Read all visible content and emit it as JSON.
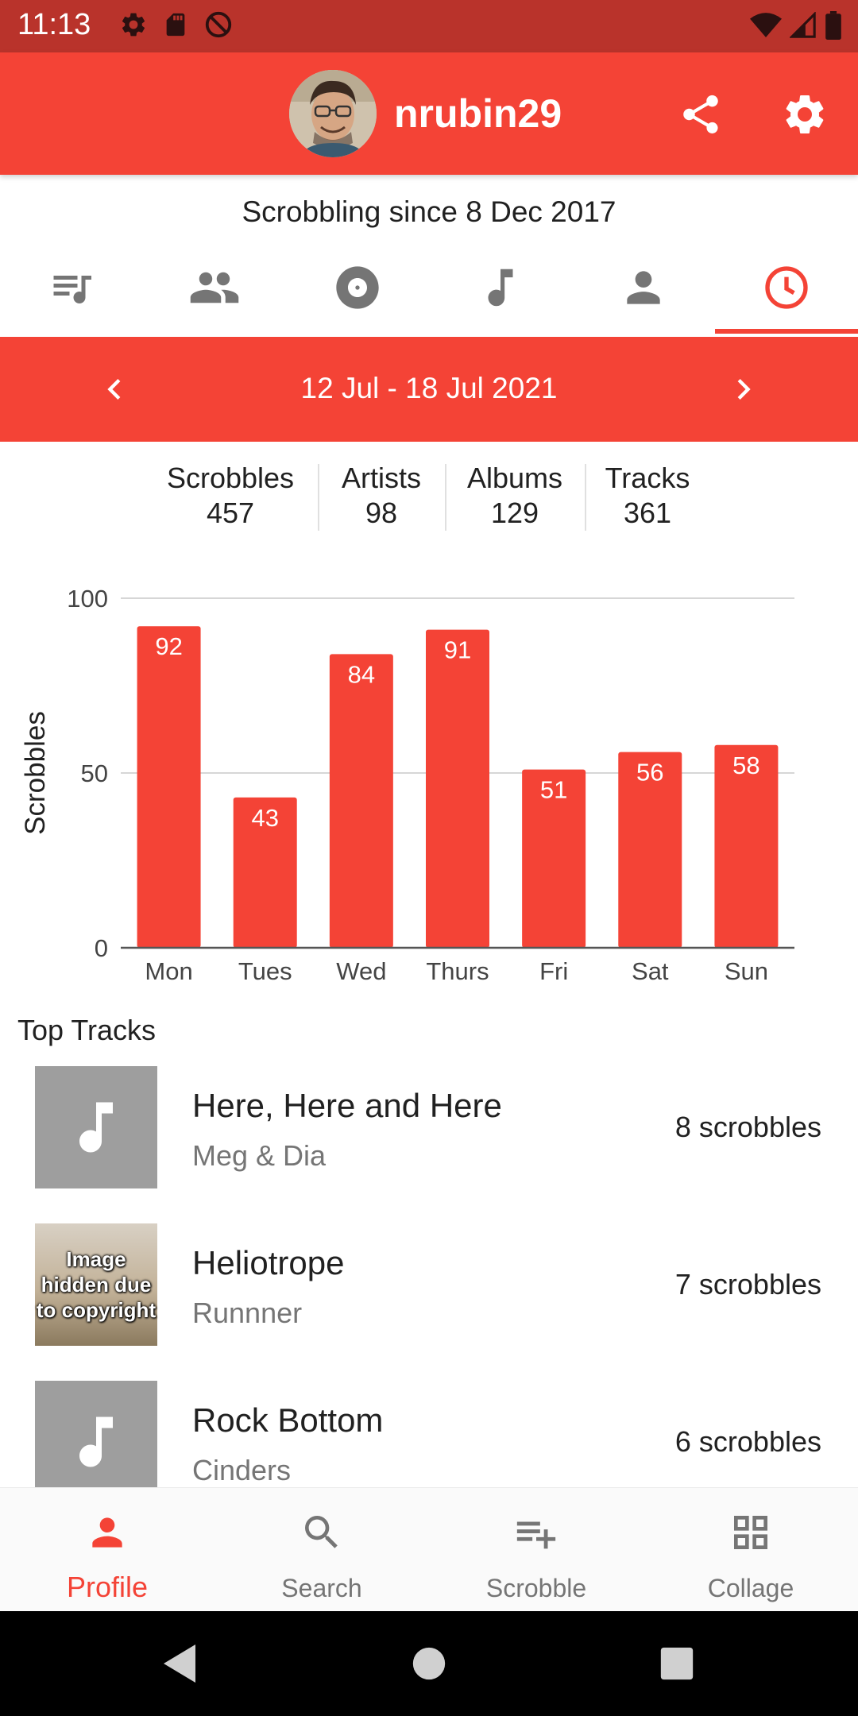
{
  "status_bar": {
    "time": "11:13"
  },
  "header": {
    "username": "nrubin29"
  },
  "profile": {
    "since": "Scrobbling since 8 Dec 2017"
  },
  "tabs": [
    {
      "name": "recent-tracks",
      "icon": "queue-music-icon"
    },
    {
      "name": "friends",
      "icon": "people-icon"
    },
    {
      "name": "albums",
      "icon": "album-icon"
    },
    {
      "name": "tracks",
      "icon": "music-note-icon"
    },
    {
      "name": "artists",
      "icon": "person-icon"
    },
    {
      "name": "weekly",
      "icon": "clock-icon",
      "active": true
    }
  ],
  "week": {
    "label": "12 Jul - 18 Jul 2021"
  },
  "stats": [
    {
      "label": "Scrobbles",
      "value": "457"
    },
    {
      "label": "Artists",
      "value": "98"
    },
    {
      "label": "Albums",
      "value": "129"
    },
    {
      "label": "Tracks",
      "value": "361"
    }
  ],
  "chart_data": {
    "type": "bar",
    "categories": [
      "Mon",
      "Tues",
      "Wed",
      "Thurs",
      "Fri",
      "Sat",
      "Sun"
    ],
    "values": [
      92,
      43,
      84,
      91,
      51,
      56,
      58
    ],
    "ylabel": "Scrobbles",
    "xlabel": "",
    "ylim": [
      0,
      100
    ],
    "yticks": [
      "0",
      "50",
      "100"
    ],
    "bar_color": "#f44336",
    "grid": true
  },
  "top_tracks": {
    "title": "Top Tracks",
    "items": [
      {
        "name": "Here, Here and Here",
        "artist": "Meg & Dia",
        "count": "8 scrobbles",
        "art": "music-note-placeholder"
      },
      {
        "name": "Heliotrope",
        "artist": "Runnner",
        "count": "7 scrobbles",
        "art": "Image hidden due to copyright"
      },
      {
        "name": "Rock Bottom",
        "artist": "Cinders",
        "count": "6 scrobbles",
        "art": "music-note-placeholder"
      }
    ]
  },
  "bottom_nav": [
    {
      "label": "Profile",
      "icon": "person-icon",
      "active": true
    },
    {
      "label": "Search",
      "icon": "search-icon"
    },
    {
      "label": "Scrobble",
      "icon": "playlist-add-icon"
    },
    {
      "label": "Collage",
      "icon": "grid-icon"
    }
  ],
  "colors": {
    "accent": "#f44336",
    "status_bar": "#b9332b",
    "inactive_icon": "#757575"
  }
}
